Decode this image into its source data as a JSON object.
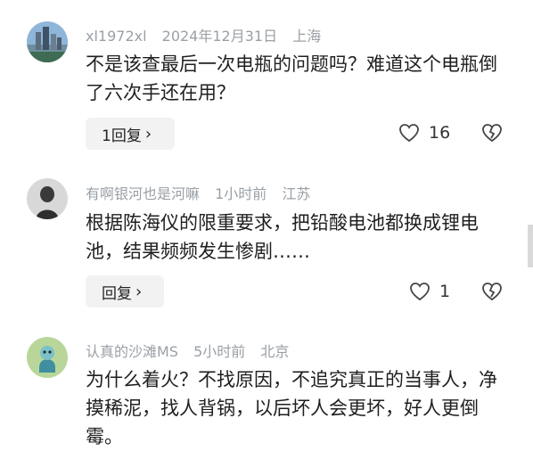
{
  "comments": [
    {
      "username": "xl1972xl",
      "time": "2024年12月31日",
      "location": "上海",
      "text": "不是该查最后一次电瓶的问题吗？难道这个电瓶倒了六次手还在用？",
      "reply_label": "1回复",
      "likes": "16"
    },
    {
      "username": "有啊银河也是河嘛",
      "time": "1小时前",
      "location": "江苏",
      "text": "根据陈海仪的限重要求，把铅酸电池都换成锂电池，结果频频发生惨剧……",
      "reply_label": "回复",
      "likes": "1"
    },
    {
      "username": "认真的沙滩MS",
      "time": "5小时前",
      "location": "北京",
      "text": "为什么着火？不找原因，不追究真正的当事人，净摸稀泥，找人背锅，以后坏人会更坏，好人更倒霉。"
    }
  ],
  "icons": {
    "like": "heart-outline-icon",
    "dislike": "broken-heart-icon",
    "chevron": "chevron-right-icon"
  }
}
